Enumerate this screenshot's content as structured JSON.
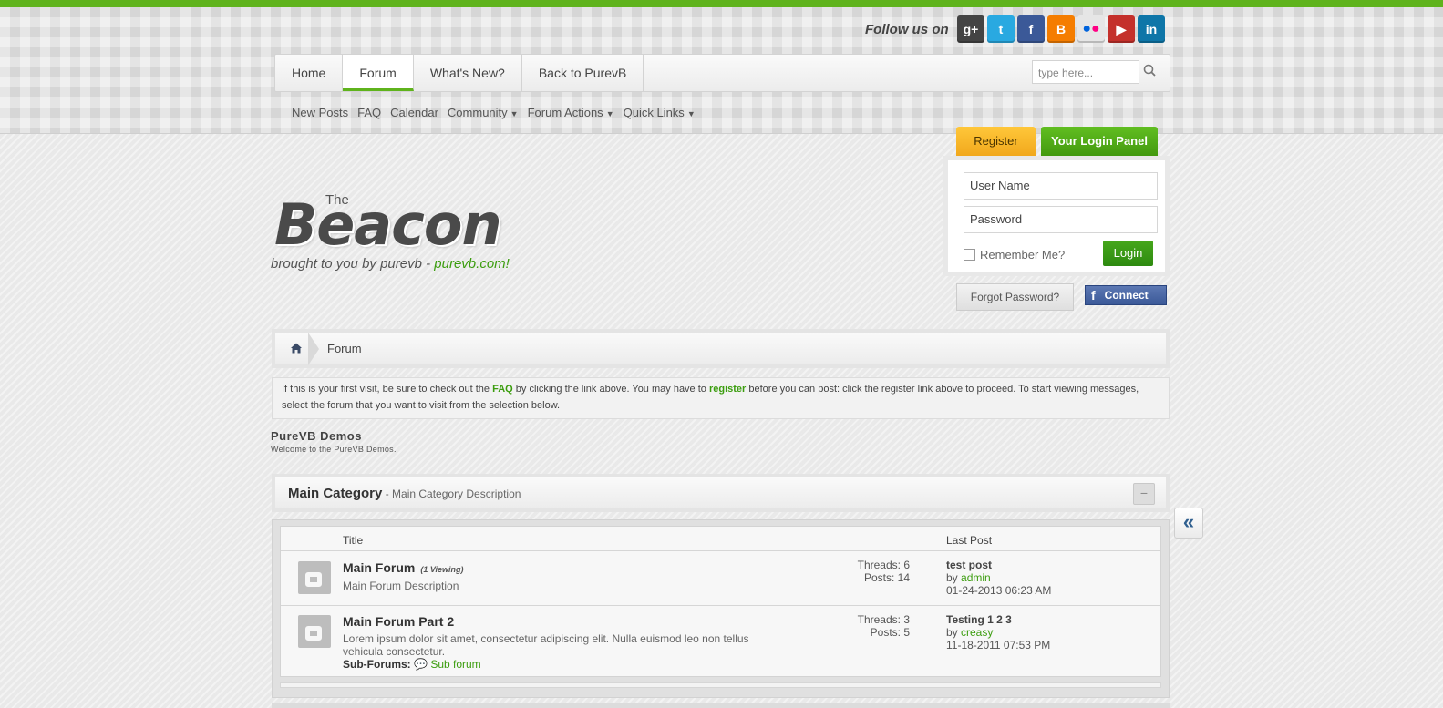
{
  "social": {
    "follow_label": "Follow us on",
    "icons": [
      {
        "name": "google-plus-icon",
        "glyph": "g+",
        "color": "#444"
      },
      {
        "name": "twitter-icon",
        "glyph": "t",
        "color": "#29a9e1"
      },
      {
        "name": "facebook-icon",
        "glyph": "f",
        "color": "#3b5998"
      },
      {
        "name": "blogger-icon",
        "glyph": "B",
        "color": "#f57d00"
      },
      {
        "name": "flickr-icon",
        "glyph": "••",
        "color": "#e6e6e6"
      },
      {
        "name": "youtube-icon",
        "glyph": "▶",
        "color": "#c4302b"
      },
      {
        "name": "linkedin-icon",
        "glyph": "in",
        "color": "#0e76a8"
      }
    ]
  },
  "nav": {
    "tabs": [
      "Home",
      "Forum",
      "What's New?",
      "Back to PurevB"
    ],
    "active_tab": "Forum",
    "search_placeholder": "type here..."
  },
  "subnav": {
    "links": [
      "New Posts",
      "FAQ",
      "Calendar"
    ],
    "menus": [
      "Community",
      "Forum Actions",
      "Quick Links"
    ]
  },
  "login": {
    "register_tab": "Register",
    "panel_tab": "Your Login Panel",
    "username_placeholder": "User Name",
    "password_placeholder": "Password",
    "remember_label": "Remember Me?",
    "login_button": "Login",
    "forgot_label": "Forgot Password?",
    "fb_connect_label": "Connect"
  },
  "logo": {
    "the": "The",
    "name": "Beacon",
    "tagline": "brought to you by purevb - ",
    "tagline_link": "purevb.com!"
  },
  "breadcrumb": {
    "current": "Forum"
  },
  "notice": {
    "part1": "If this is your first visit, be sure to check out the ",
    "faq": "FAQ",
    "part2": " by clicking the link above. You may have to ",
    "register": "register",
    "part3": " before you can post: click the register link above to proceed. To start viewing messages, select the forum that you want to visit from the selection below."
  },
  "section": {
    "title": "PureVB Demos",
    "description": "Welcome to the PureVB Demos."
  },
  "category": {
    "name": "Main Category",
    "description": " - Main Category Description"
  },
  "table": {
    "col_title": "Title",
    "col_last": "Last Post",
    "forums": [
      {
        "name": "Main Forum",
        "viewing": "(1 Viewing)",
        "description": "Main Forum Description",
        "threads": "Threads: 6",
        "posts": "Posts: 14",
        "last_title": "test post",
        "last_by": "by ",
        "last_user": "admin",
        "last_date": "01-24-2013 06:23 AM"
      },
      {
        "name": "Main Forum Part 2",
        "description": "Lorem ipsum dolor sit amet, consectetur adipiscing elit. Nulla euismod leo non tellus vehicula consectetur.",
        "subforums_label": "Sub-Forums:",
        "subforum": "Sub forum",
        "threads": "Threads: 3",
        "posts": "Posts: 5",
        "last_title": "Testing 1 2 3",
        "last_by": "by ",
        "last_user": "creasy",
        "last_date": "11-18-2011 07:53 PM"
      }
    ]
  }
}
